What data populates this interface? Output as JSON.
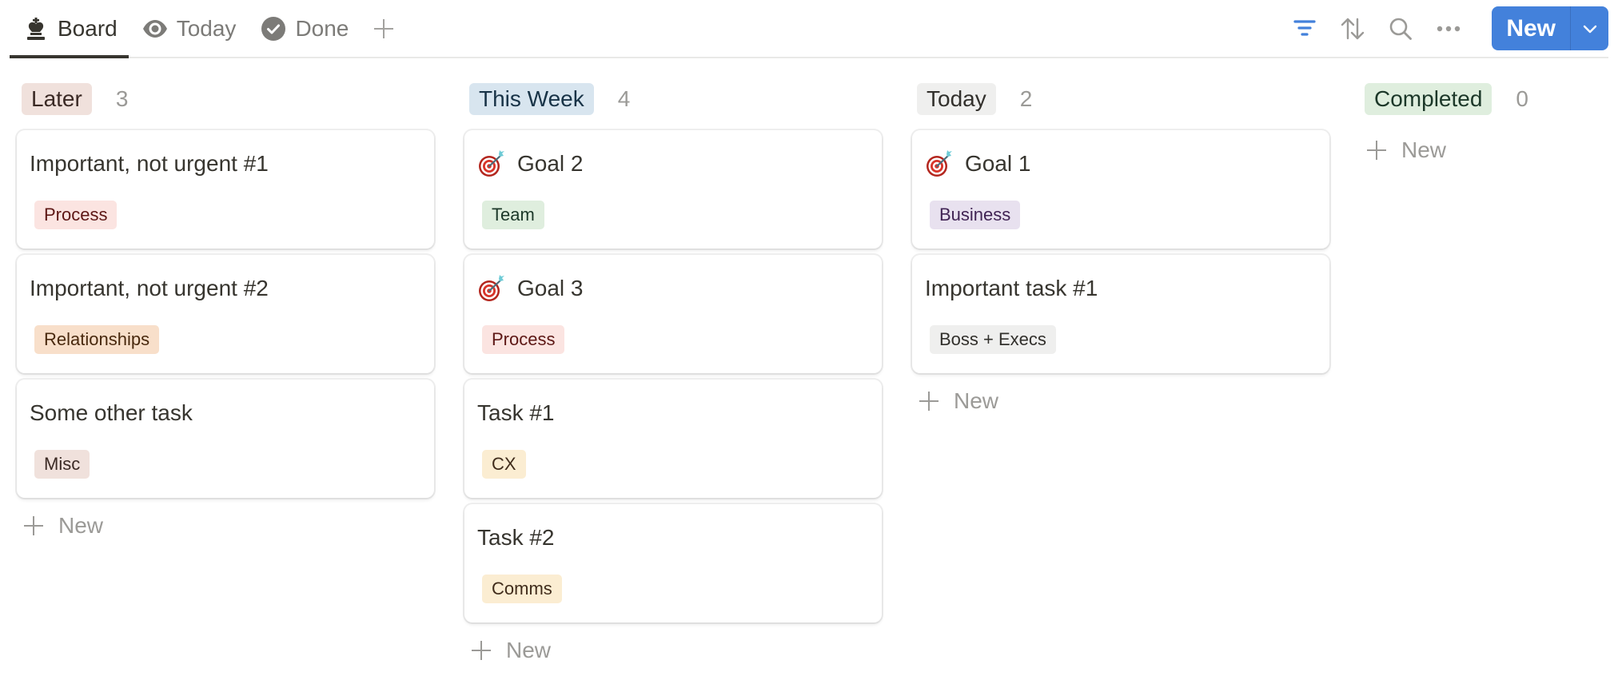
{
  "tabs": [
    {
      "label": "Board",
      "icon": "chess-king-icon",
      "active": true
    },
    {
      "label": "Today",
      "icon": "eye-icon",
      "active": false
    },
    {
      "label": "Done",
      "icon": "check-circle-icon",
      "active": false
    }
  ],
  "toolbar": {
    "add_view_icon": "plus-icon",
    "filter_icon": "filter-icon",
    "sort_icon": "sort-icon",
    "search_icon": "search-icon",
    "more_icon": "more-icon",
    "new_label": "New",
    "new_caret_icon": "chevron-down-icon"
  },
  "colors": {
    "accent": "#4381db",
    "filter_active": "#4381db"
  },
  "columns": [
    {
      "name": "Later",
      "count": "3",
      "pill_bg": "#f0e1dc",
      "pill_fg": "#3b2a25",
      "cards": [
        {
          "title": "Important, not urgent #1",
          "emoji": false,
          "tag": "Process",
          "tag_bg": "#fbe4e1",
          "tag_fg": "#5d1715"
        },
        {
          "title": "Important, not urgent #2",
          "emoji": false,
          "tag": "Relationships",
          "tag_bg": "#f8dfca",
          "tag_fg": "#49290e"
        },
        {
          "title": "Some other task",
          "emoji": false,
          "tag": "Misc",
          "tag_bg": "#f0e1dc",
          "tag_fg": "#3b2a25"
        }
      ],
      "new_label": "New"
    },
    {
      "name": "This Week",
      "count": "4",
      "pill_bg": "#d8e5ef",
      "pill_fg": "#183347",
      "cards": [
        {
          "title": "Goal 2",
          "emoji": true,
          "tag": "Team",
          "tag_bg": "#dfeede",
          "tag_fg": "#1c3829"
        },
        {
          "title": "Goal 3",
          "emoji": true,
          "tag": "Process",
          "tag_bg": "#fbe4e1",
          "tag_fg": "#5d1715"
        },
        {
          "title": "Task #1",
          "emoji": false,
          "tag": "CX",
          "tag_bg": "#fbedd2",
          "tag_fg": "#402c1b"
        },
        {
          "title": "Task #2",
          "emoji": false,
          "tag": "Comms",
          "tag_bg": "#fbedd2",
          "tag_fg": "#402c1b"
        }
      ],
      "new_label": "New"
    },
    {
      "name": "Today",
      "count": "2",
      "pill_bg": "#efefee",
      "pill_fg": "#32302c",
      "cards": [
        {
          "title": "Goal 1",
          "emoji": true,
          "tag": "Business",
          "tag_bg": "#e8e1ef",
          "tag_fg": "#412454"
        },
        {
          "title": "Important task #1",
          "emoji": false,
          "tag": "Boss + Execs",
          "tag_bg": "#efefee",
          "tag_fg": "#32302c"
        }
      ],
      "new_label": "New"
    },
    {
      "name": "Completed",
      "count": "0",
      "pill_bg": "#dfeede",
      "pill_fg": "#1c3829",
      "cards": [],
      "new_label": "New"
    }
  ]
}
